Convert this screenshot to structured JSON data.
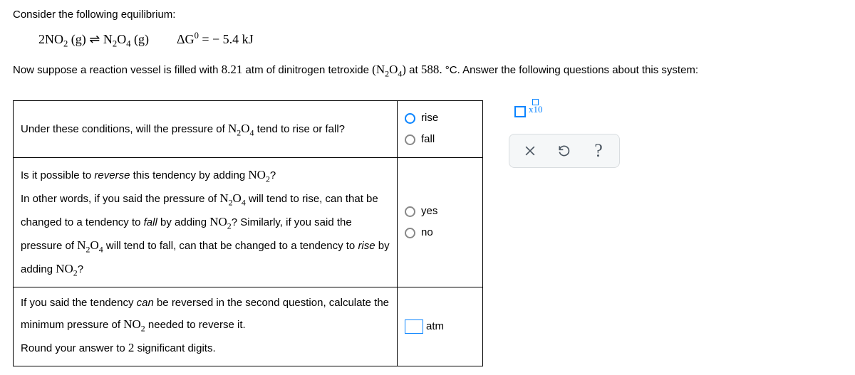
{
  "intro": "Consider the following equilibrium:",
  "equation": {
    "lhs": "2NO",
    "lhs_sub": "2",
    "lhs_state": "(g)",
    "arrow": "⇌",
    "rhs": "N",
    "rhs_sub1": "2",
    "rhs_mid": "O",
    "rhs_sub2": "4",
    "rhs_state": "(g)",
    "dg_label": "ΔG",
    "dg_sup": "0",
    "dg_eq": "= − 5.4 kJ"
  },
  "context": {
    "p1": "Now suppose a reaction vessel is filled with ",
    "atm": "8.21",
    "p2": " atm of dinitrogen tetroxide ",
    "species_open": "(",
    "species_n": "N",
    "species_sub1": "2",
    "species_o": "O",
    "species_sub2": "4",
    "species_close": ")",
    "p3": " at ",
    "temp": "588.",
    "p4": " °C. Answer the following questions about this system:"
  },
  "q1": {
    "t1": "Under these conditions, will the pressure of ",
    "sp_n": "N",
    "sp_s1": "2",
    "sp_o": "O",
    "sp_s2": "4",
    "t2": " tend to rise or fall?",
    "opt_rise": "rise",
    "opt_fall": "fall"
  },
  "q2": {
    "line1a": "Is it possible to ",
    "line1b": "reverse",
    "line1c": " this tendency by adding ",
    "no2_n": "NO",
    "no2_s": "2",
    "line1d": "?",
    "line2a": "In other words, if you said the pressure of ",
    "n2o4_n": "N",
    "n2o4_s1": "2",
    "n2o4_o": "O",
    "n2o4_s2": "4",
    "line2b": " will tend to rise, can that be changed to a tendency to ",
    "fall_i": "fall",
    "line2c": " by adding ",
    "line2d": "? Similarly, if you said the pressure of ",
    "line2e": " will tend to fall, can that be changed to a tendency to ",
    "rise_i": "rise",
    "line2f": " by adding ",
    "line2g": "?",
    "opt_yes": "yes",
    "opt_no": "no"
  },
  "q3": {
    "t1": "If you said the tendency ",
    "can_i": "can",
    "t2": " be reversed in the second question, calculate the minimum pressure of ",
    "no2_n": "NO",
    "no2_s": "2",
    "t3": " needed to reverse it.",
    "round": "Round your answer to ",
    "sig": "2",
    "round2": " significant digits.",
    "unit": "atm"
  },
  "side": {
    "sci_label": "x10"
  }
}
